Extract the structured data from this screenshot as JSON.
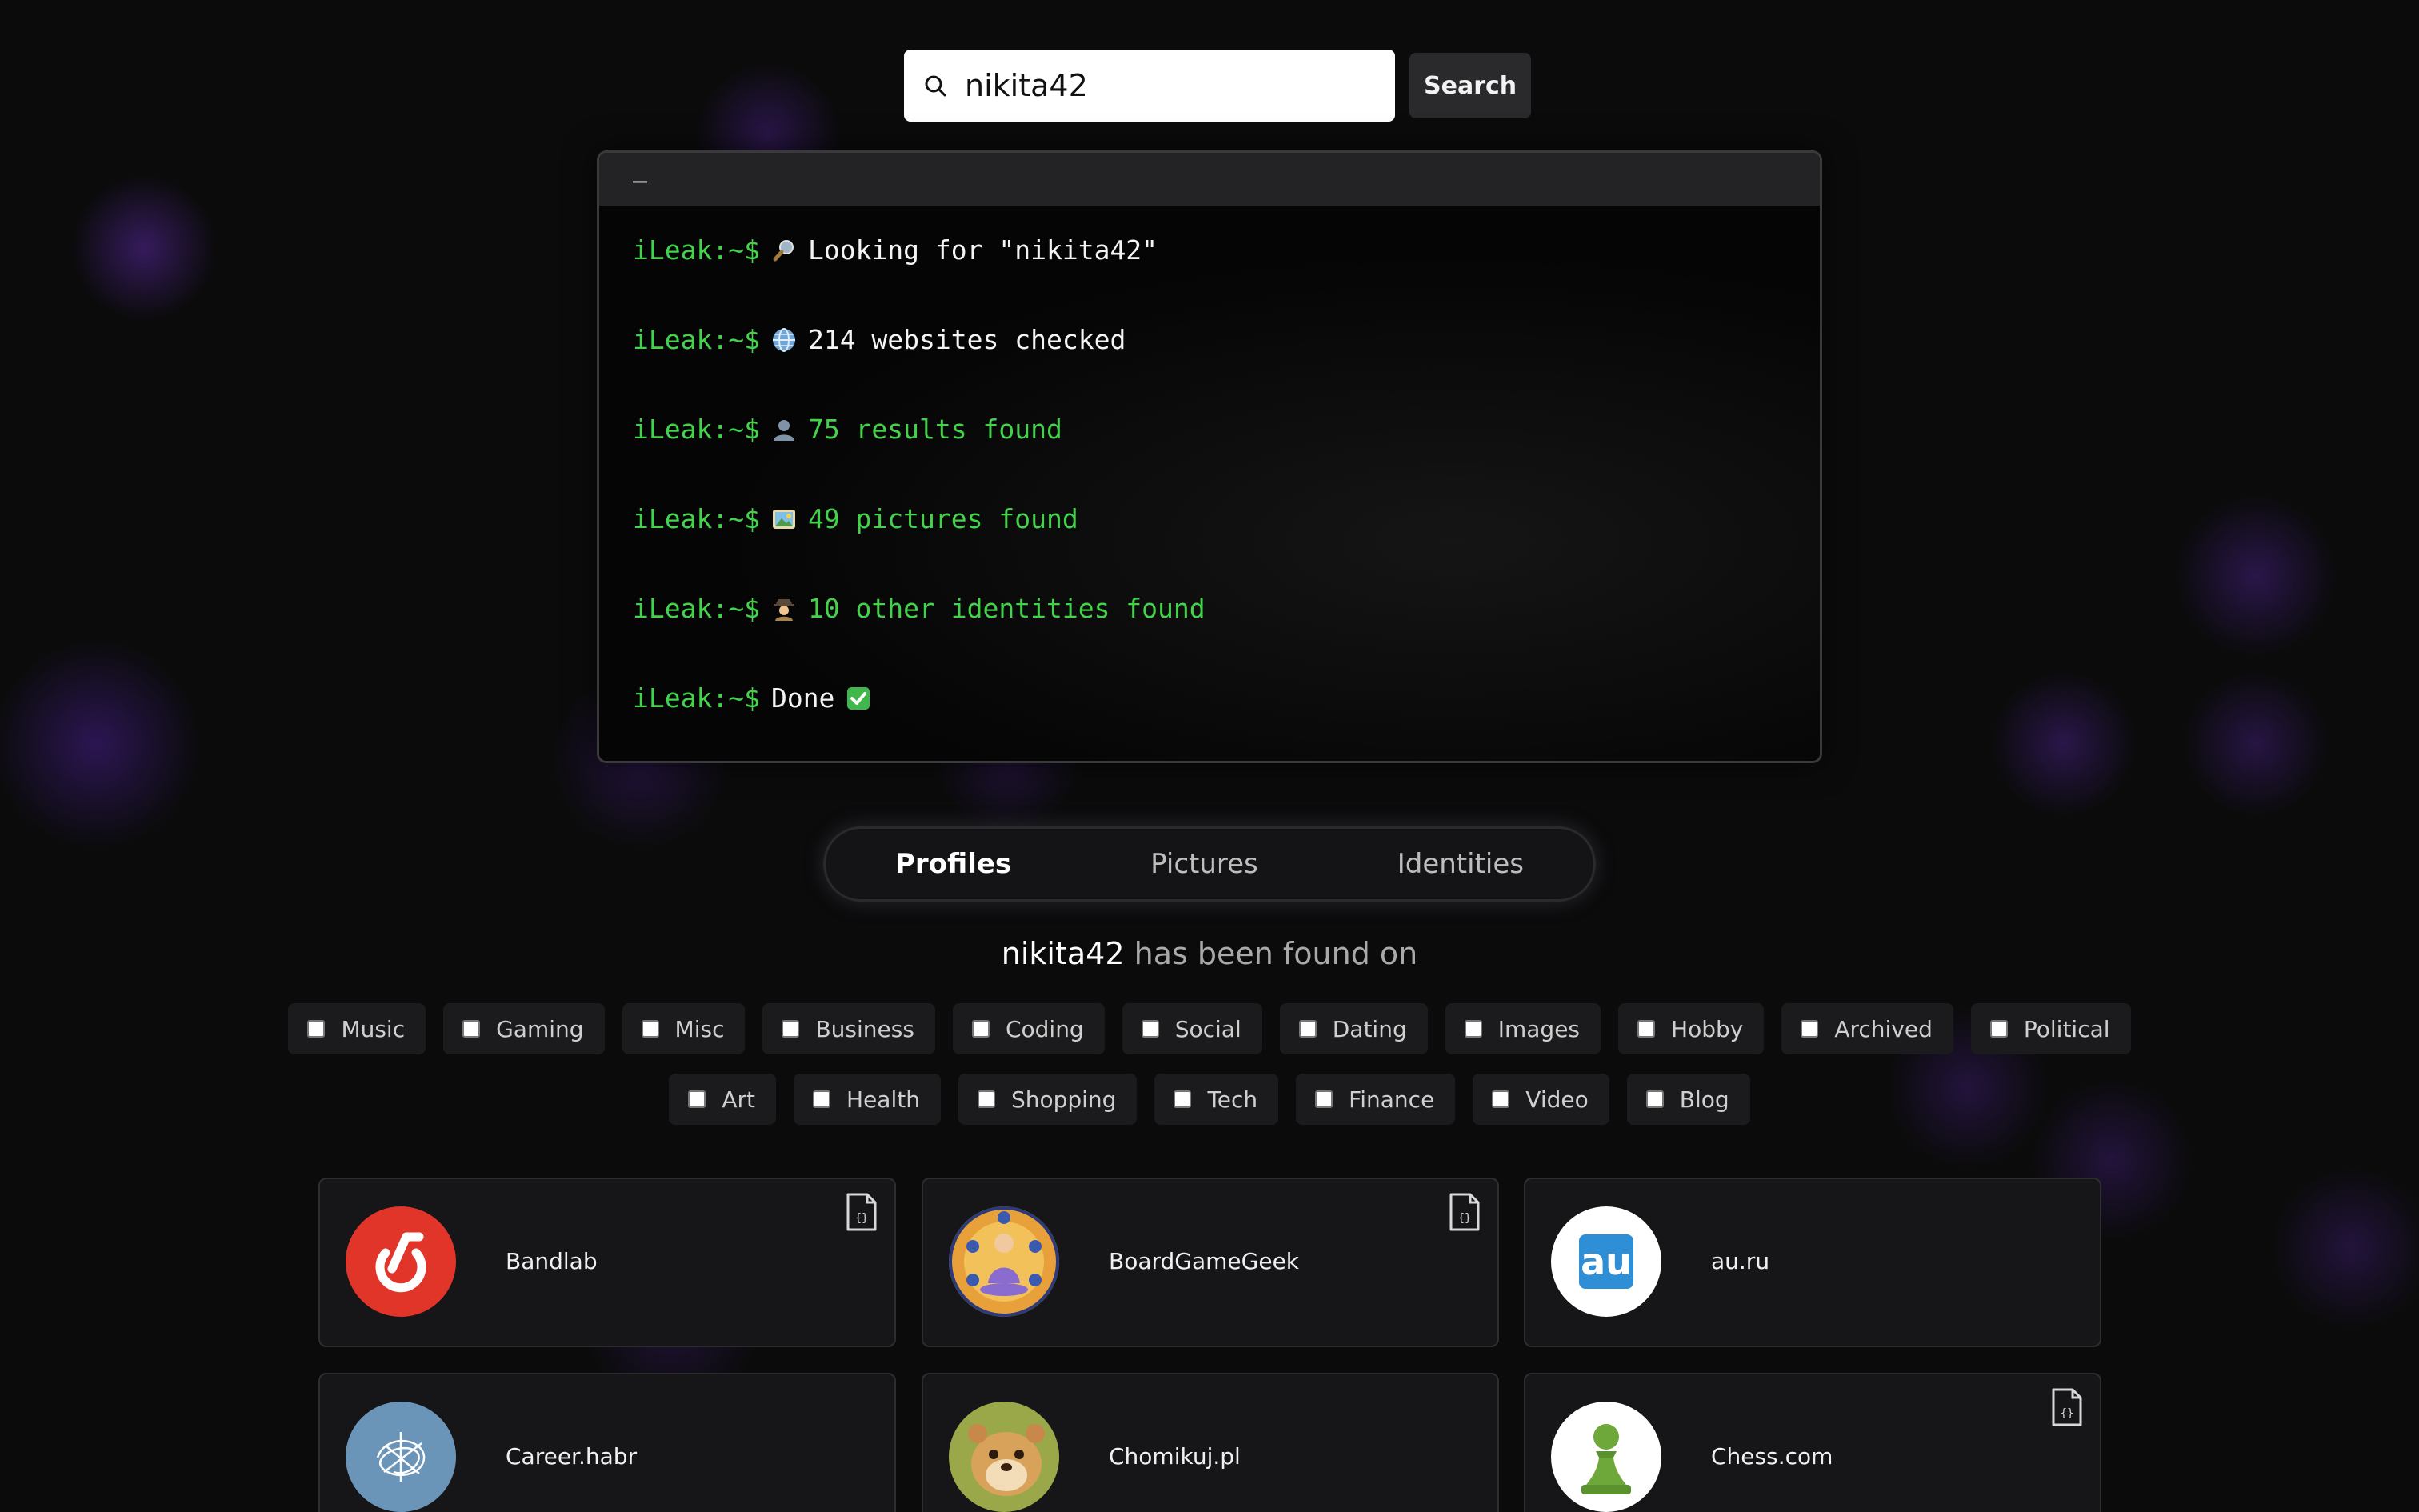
{
  "search": {
    "value": "nikita42",
    "button_label": "Search"
  },
  "terminal": {
    "title_bar": "–",
    "lines": [
      {
        "prompt": "iLeak:~$",
        "icon": "magnifier-icon",
        "text": "Looking for \"nikita42\"",
        "color": "white"
      },
      {
        "prompt": "iLeak:~$",
        "icon": "globe-icon",
        "text": "214 websites checked",
        "color": "white"
      },
      {
        "prompt": "iLeak:~$",
        "icon": "user-icon",
        "text": "75 results found",
        "color": "green"
      },
      {
        "prompt": "iLeak:~$",
        "icon": "picture-icon",
        "text": "49 pictures found",
        "color": "green"
      },
      {
        "prompt": "iLeak:~$",
        "icon": "detective-icon",
        "text": "10 other identities found",
        "color": "green"
      },
      {
        "prompt": "iLeak:~$",
        "icon": "check-icon",
        "text": "Done",
        "color": "white"
      }
    ]
  },
  "tabs": [
    {
      "label": "Profiles",
      "active": true
    },
    {
      "label": "Pictures",
      "active": false
    },
    {
      "label": "Identities",
      "active": false
    }
  ],
  "found": {
    "username": "nikita42",
    "suffix": "has been found on"
  },
  "filters_row1": [
    "Music",
    "Gaming",
    "Misc",
    "Business",
    "Coding",
    "Social",
    "Dating",
    "Images",
    "Hobby",
    "Archived",
    "Political"
  ],
  "filters_row2": [
    "Art",
    "Health",
    "Shopping",
    "Tech",
    "Finance",
    "Video",
    "Blog"
  ],
  "profiles": [
    {
      "name": "Bandlab",
      "logo": "bandlab-logo",
      "has_json": true
    },
    {
      "name": "BoardGameGeek",
      "logo": "boardgamegeek-avatar",
      "has_json": true
    },
    {
      "name": "au.ru",
      "logo": "auru-logo",
      "logo_text": "au",
      "has_json": false
    },
    {
      "name": "Career.habr",
      "logo": "career-habr-avatar",
      "has_json": false
    },
    {
      "name": "Chomikuj.pl",
      "logo": "chomikuj-avatar",
      "has_json": false
    },
    {
      "name": "Chess.com",
      "logo": "chess-pawn-logo",
      "has_json": true
    }
  ],
  "colors": {
    "prompt_green": "#43d24a",
    "bandlab_red": "#e2352a",
    "auru_blue": "#2f8fd6"
  }
}
